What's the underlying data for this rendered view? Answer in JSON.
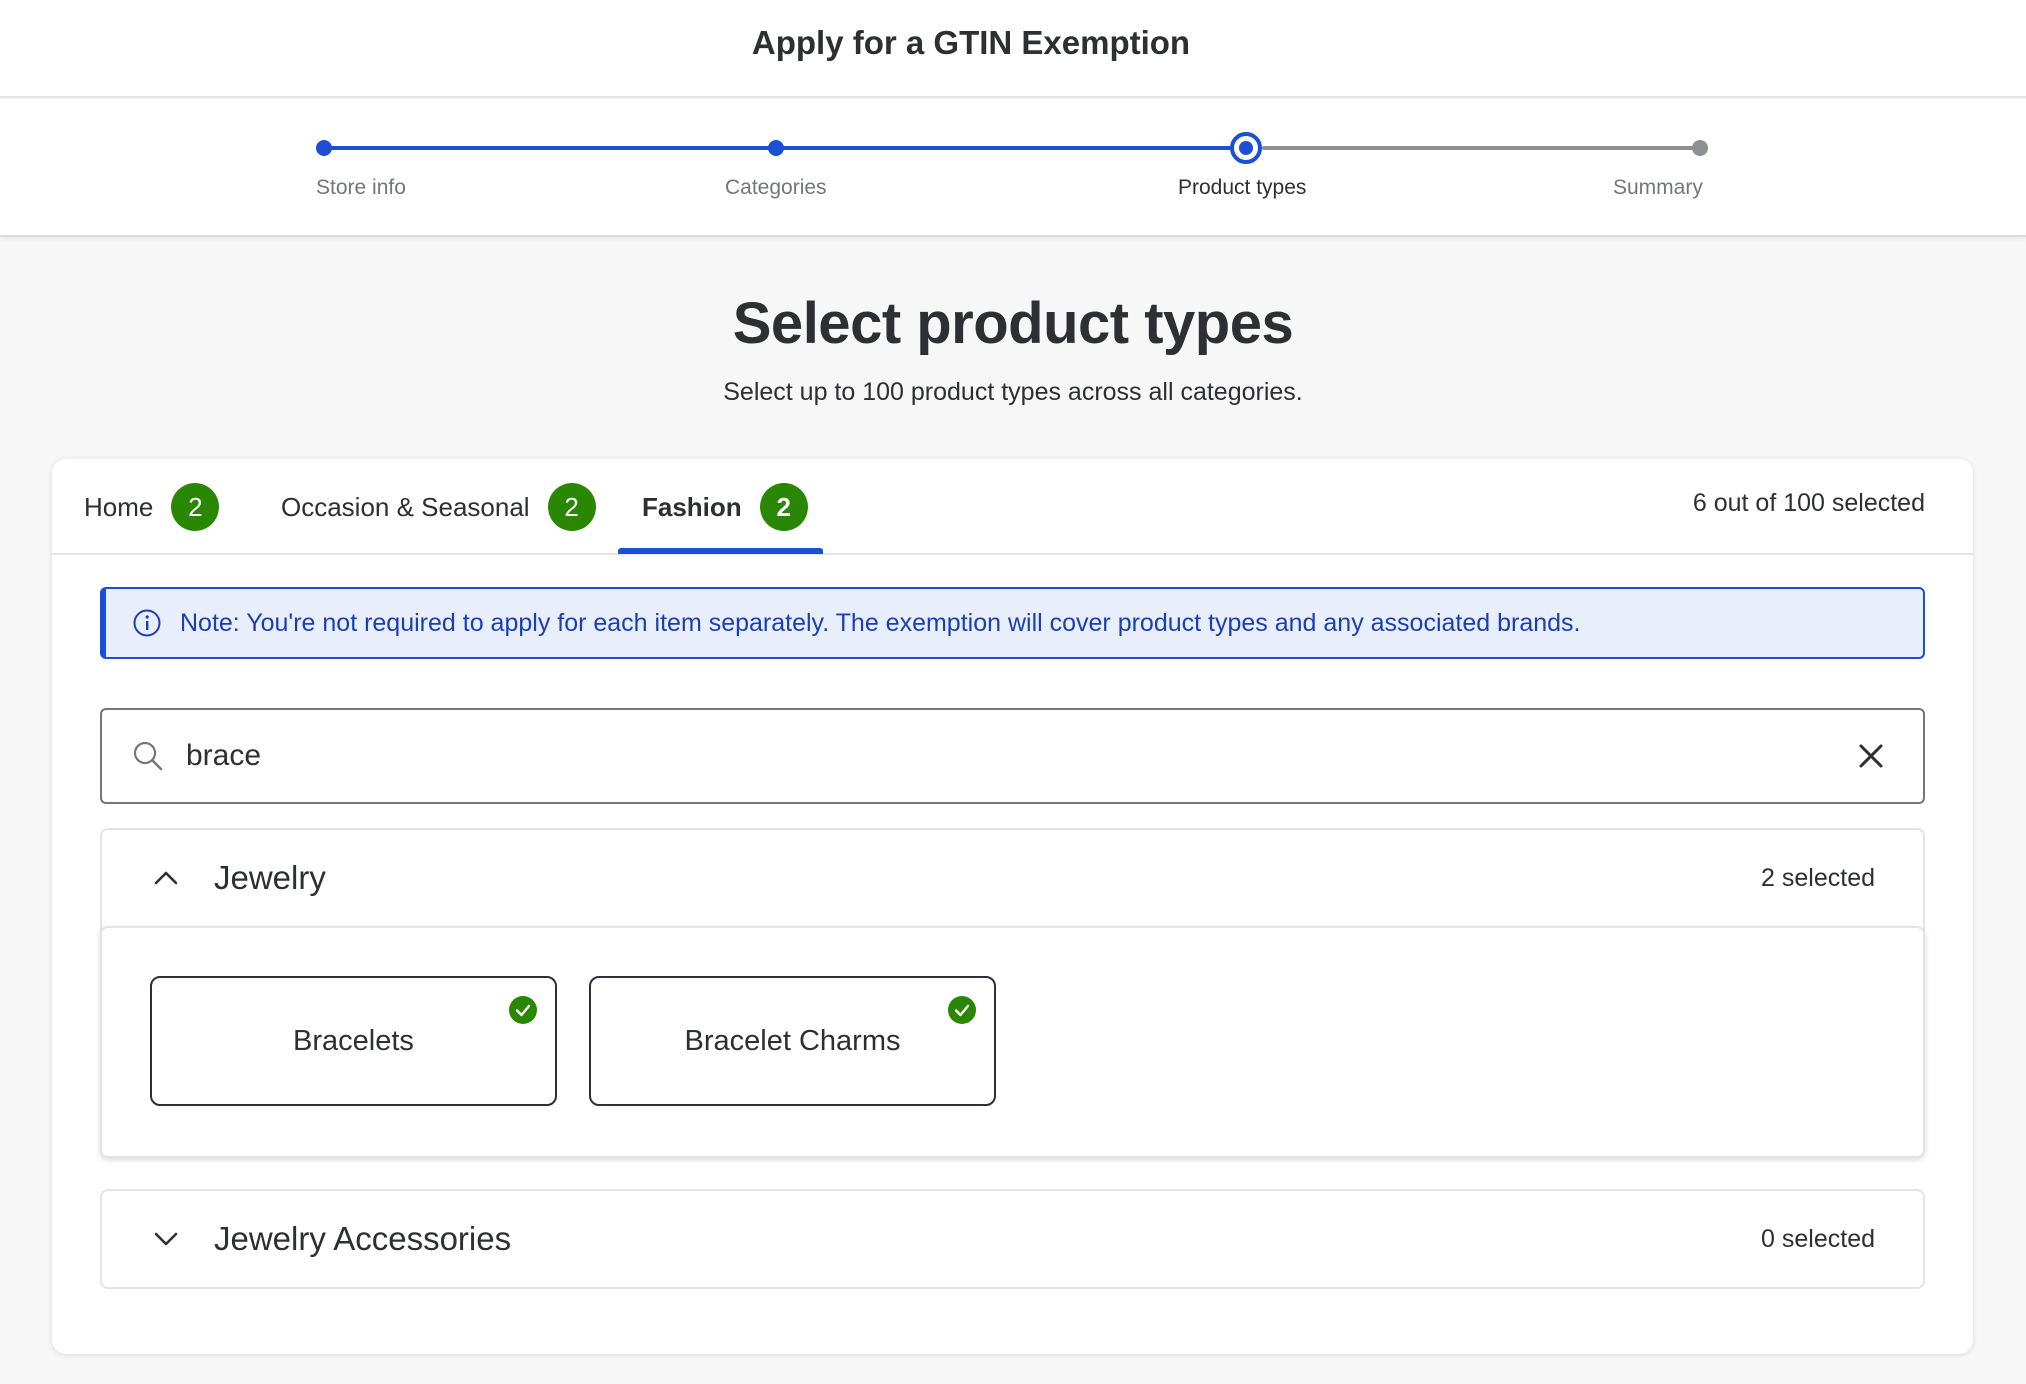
{
  "header": {
    "title": "Apply for a GTIN Exemption"
  },
  "stepper": {
    "steps": [
      {
        "label": "Store info",
        "state": "done"
      },
      {
        "label": "Categories",
        "state": "done"
      },
      {
        "label": "Product types",
        "state": "current"
      },
      {
        "label": "Summary",
        "state": "todo"
      }
    ]
  },
  "page": {
    "title": "Select product types",
    "subtitle": "Select up to 100 product types across all categories."
  },
  "tabs": {
    "items": [
      {
        "label": "Home",
        "badge": "2"
      },
      {
        "label": "Occasion & Seasonal",
        "badge": "2"
      },
      {
        "label": "Fashion",
        "badge": "2",
        "active": true
      }
    ],
    "selected_count": "6 out of 100 selected"
  },
  "note": {
    "text": "Note: You're not required to apply for each item separately. The exemption will cover product types and any associated brands."
  },
  "search": {
    "value": "brace"
  },
  "groups": [
    {
      "title": "Jewelry",
      "count": "2 selected",
      "expanded": true,
      "items": [
        {
          "label": "Bracelets",
          "selected": true
        },
        {
          "label": "Bracelet Charms",
          "selected": true
        }
      ]
    },
    {
      "title": "Jewelry Accessories",
      "count": "0 selected",
      "expanded": false
    }
  ],
  "colors": {
    "accent": "#1a4fd6",
    "badge": "#2a8703",
    "note_bg": "#e8eefc",
    "text": "#2e2f32",
    "muted": "#74767c"
  }
}
